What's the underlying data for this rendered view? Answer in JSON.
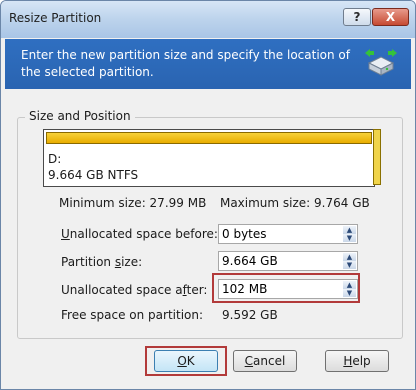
{
  "window": {
    "title": "Resize Partition",
    "help_button": "?",
    "close_button": "X"
  },
  "header": {
    "text": "Enter the new partition size and specify the location of the selected partition.",
    "icon": "disk-resize-icon"
  },
  "group": {
    "label": "Size and Position"
  },
  "partition": {
    "drive": "D:",
    "info": "9.664 GB  NTFS",
    "bar_color": "#efc012"
  },
  "sizes": {
    "minimum": "Minimum size: 27.99 MB",
    "maximum": "Maximum size: 9.764 GB"
  },
  "fields": {
    "unallocated_before": {
      "label_pre": "",
      "label_key": "U",
      "label_post": "nallocated space before:",
      "value": "0 bytes"
    },
    "partition_size": {
      "label_pre": "Partition ",
      "label_key": "s",
      "label_post": "ize:",
      "value": "9.664 GB"
    },
    "unallocated_after": {
      "label_pre": "Unallocated space a",
      "label_key": "f",
      "label_post": "ter:",
      "value": "102 MB"
    },
    "free_space": {
      "label": "Free space on partition:",
      "value": "9.592 GB"
    }
  },
  "buttons": {
    "ok": {
      "key": "O",
      "rest": "K"
    },
    "cancel": {
      "key": "C",
      "rest": "ancel"
    },
    "help": {
      "key": "H",
      "rest": "elp"
    }
  },
  "colors": {
    "highlight": "#b23a3a",
    "header": "#2f6fc1"
  }
}
